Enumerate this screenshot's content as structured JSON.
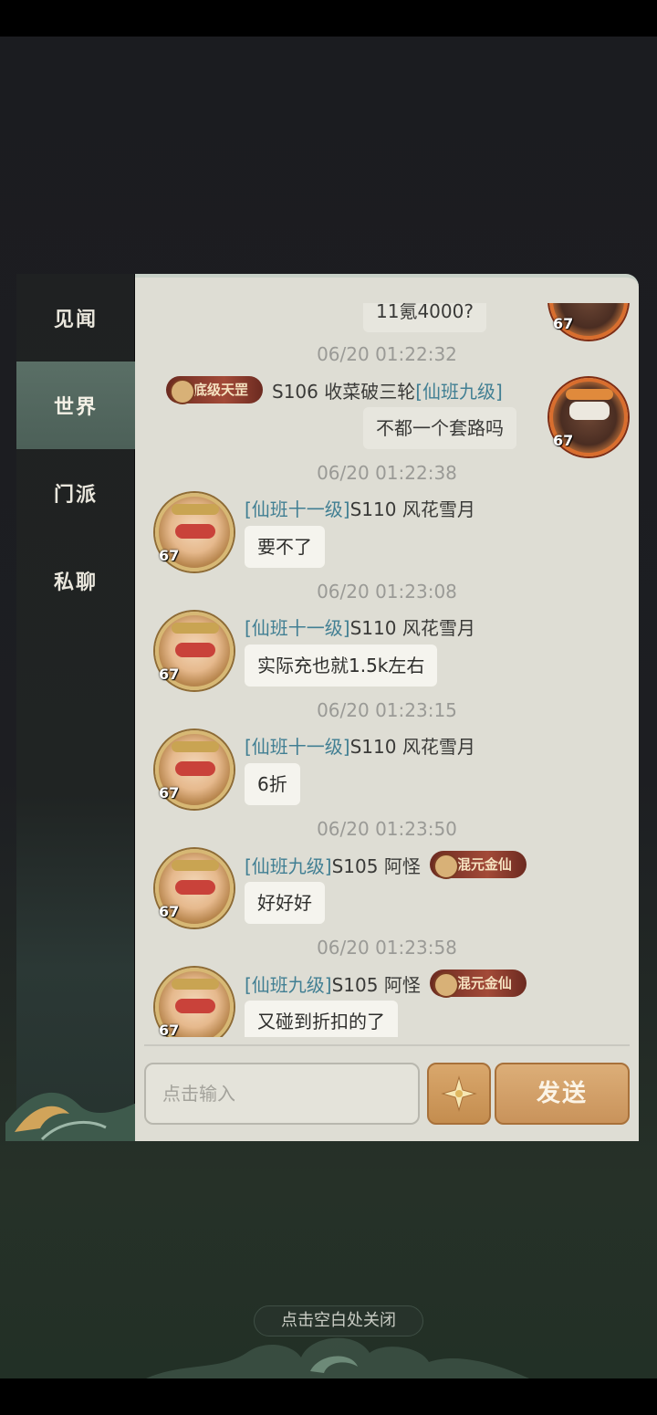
{
  "sidebar": {
    "tabs": [
      {
        "label": "见闻",
        "active": false
      },
      {
        "label": "世界",
        "active": true
      },
      {
        "label": "门派",
        "active": false
      },
      {
        "label": "私聊",
        "active": false
      }
    ]
  },
  "chat": {
    "messages": [
      {
        "type": "self",
        "text": "11氪4000?",
        "level": "67"
      },
      {
        "type": "time",
        "text": "06/20 01:22:32"
      },
      {
        "type": "self",
        "title_badge": "底级天罡",
        "name": "S106 收菜破三轮",
        "rank": "[仙班九级]",
        "text": "不都一个套路吗",
        "level": "67"
      },
      {
        "type": "time",
        "text": "06/20 01:22:38"
      },
      {
        "type": "other",
        "rank": "[仙班十一级]",
        "name": "S110 风花雪月",
        "text": "要不了",
        "level": "67"
      },
      {
        "type": "time",
        "text": "06/20 01:23:08"
      },
      {
        "type": "other",
        "rank": "[仙班十一级]",
        "name": "S110 风花雪月",
        "text": "实际充也就1.5k左右",
        "level": "67"
      },
      {
        "type": "time",
        "text": "06/20 01:23:15"
      },
      {
        "type": "other",
        "rank": "[仙班十一级]",
        "name": "S110 风花雪月",
        "text": "6折",
        "level": "67"
      },
      {
        "type": "time",
        "text": "06/20 01:23:50"
      },
      {
        "type": "other",
        "rank": "[仙班九级]",
        "name": "S105 阿怪",
        "title_badge": "混元金仙",
        "text": "好好好",
        "level": "67"
      },
      {
        "type": "time",
        "text": "06/20 01:23:58"
      },
      {
        "type": "other",
        "rank": "[仙班九级]",
        "name": "S105 阿怪",
        "title_badge": "混元金仙",
        "text": "又碰到折扣的了",
        "level": "67"
      }
    ]
  },
  "input": {
    "placeholder": "点击输入",
    "send_label": "发送"
  },
  "close_hint": "点击空白处关闭",
  "colors": {
    "rank_text": "#417f93",
    "send_button": "#c9935b",
    "chat_bg": "#deddd4"
  },
  "icons": {
    "emoji_button": "sparkle-flower-icon"
  }
}
